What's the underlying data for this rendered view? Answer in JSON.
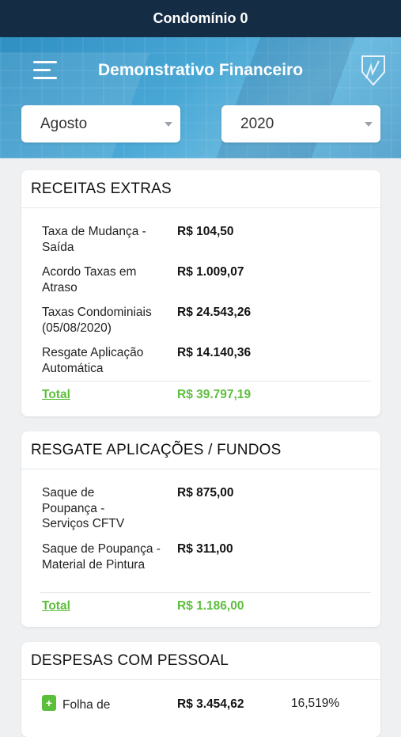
{
  "status_bar": {
    "title": "Condomínio 0"
  },
  "header": {
    "title": "Demonstrativo Financeiro",
    "menu_icon": "hamburger-icon",
    "logo_icon": "shield-logo-icon"
  },
  "filters": {
    "month": "Agosto",
    "year": "2020"
  },
  "sections": [
    {
      "title": "RECEITAS EXTRAS",
      "rows": [
        {
          "label": "Taxa de Mudança - Saída",
          "value": "R$ 104,50"
        },
        {
          "label": "Acordo Taxas em Atraso",
          "value": "R$ 1.009,07"
        },
        {
          "label": "Taxas Condominiais (05/08/2020)",
          "value": "R$ 24.543,26"
        },
        {
          "label": "Resgate Aplicação Automática",
          "value": "R$ 14.140,36"
        }
      ],
      "total_label": "Total",
      "total_value": "R$ 39.797,19"
    },
    {
      "title": "RESGATE APLICAÇÕES / FUNDOS",
      "rows": [
        {
          "label": "Saque de Poupança - Serviços CFTV",
          "value": "R$ 875,00"
        },
        {
          "label": "Saque de Poupança - Material de Pintura",
          "value": "R$ 311,00"
        }
      ],
      "total_label": "Total",
      "total_value": "R$ 1.186,00"
    },
    {
      "title": "DESPESAS COM PESSOAL",
      "rows": [
        {
          "label": "Folha de",
          "value": "R$ 3.454,62",
          "percent": "16,519%",
          "expand_icon": "plus-icon"
        }
      ]
    }
  ],
  "colors": {
    "topbar": "#142c44",
    "accent_green": "#5cbf3c",
    "hero_blue": "#3b9acb"
  }
}
